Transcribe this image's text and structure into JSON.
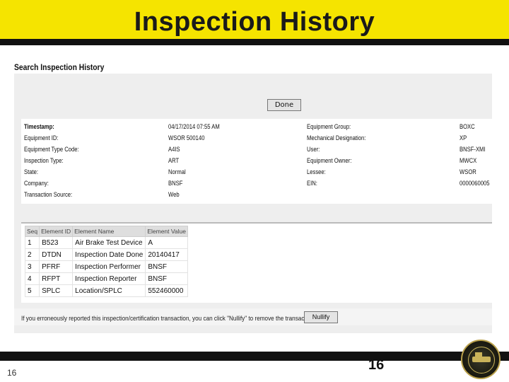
{
  "slide": {
    "title": "Inspection History",
    "page_number_left": "16",
    "page_number_center": "16"
  },
  "screen": {
    "title": "Search Inspection History",
    "done_label": "Done",
    "info_left": [
      {
        "label": "Timestamp:",
        "value": "04/17/2014 07:55 AM"
      },
      {
        "label": "Equipment ID:",
        "value": "WSOR 500140"
      },
      {
        "label": "Equipment Type Code:",
        "value": "A4IS"
      },
      {
        "label": "Inspection Type:",
        "value": "ART"
      },
      {
        "label": "State:",
        "value": "Normal"
      },
      {
        "label": "Company:",
        "value": "BNSF"
      },
      {
        "label": "Transaction Source:",
        "value": "Web"
      }
    ],
    "info_right": [
      {
        "label": "Equipment Group:",
        "value": "BOXC"
      },
      {
        "label": "Mechanical Designation:",
        "value": "XP"
      },
      {
        "label": "User:",
        "value": "BNSF-XMI"
      },
      {
        "label": "Equipment Owner:",
        "value": "MWCX"
      },
      {
        "label": "Lessee:",
        "value": "WSOR"
      },
      {
        "label": "EIN:",
        "value": "0000060005"
      }
    ],
    "elements_table": {
      "headers": [
        "Seq",
        "Element ID",
        "Element Name",
        "Element Value"
      ],
      "rows": [
        [
          "1",
          "B523",
          "Air Brake Test Device",
          "A"
        ],
        [
          "2",
          "DTDN",
          "Inspection Date Done",
          "20140417"
        ],
        [
          "3",
          "PFRF",
          "Inspection Performer",
          "BNSF"
        ],
        [
          "4",
          "RFPT",
          "Inspection Reporter",
          "BNSF"
        ],
        [
          "5",
          "SPLC",
          "Location/SPLC",
          "552460000"
        ]
      ]
    },
    "nullify_text": "If you erroneously reported this inspection/certification transaction, you can click \"Nullify\" to remove the transaction.",
    "nullify_label": "Nullify"
  },
  "colors": {
    "banner": "#f5e400",
    "bar": "#111111",
    "panel": "#eeeeee"
  }
}
